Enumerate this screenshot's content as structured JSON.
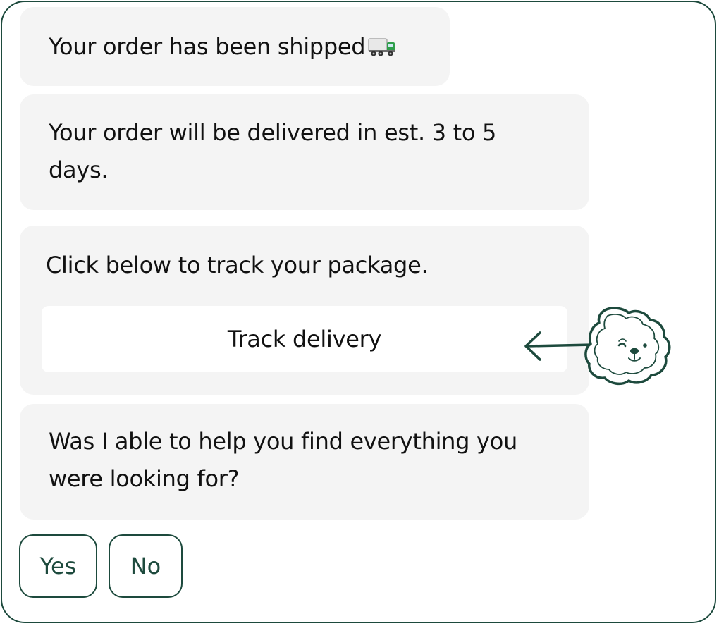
{
  "messages": [
    {
      "text": "Your order has been shipped",
      "icon": "delivery-truck-icon"
    },
    {
      "text": "Your order will be delivered in est. 3 to 5 days."
    },
    {
      "text": "Click below to track your package.",
      "button_label": "Track delivery"
    },
    {
      "text": "Was I able to help you find everything you were looking for?"
    }
  ],
  "quick_replies": [
    "Yes",
    "No"
  ],
  "mascot": {
    "icon": "dog-mascot-icon",
    "pointer": "arrow-left-icon"
  },
  "colors": {
    "frame": "#1d4a3d",
    "bubble": "#f4f4f4",
    "button_bg": "#ffffff",
    "text": "#111111",
    "reply_text": "#1d4a3d",
    "truck_cab": "#2e9e49",
    "truck_cargo": "#e8e8e8"
  }
}
